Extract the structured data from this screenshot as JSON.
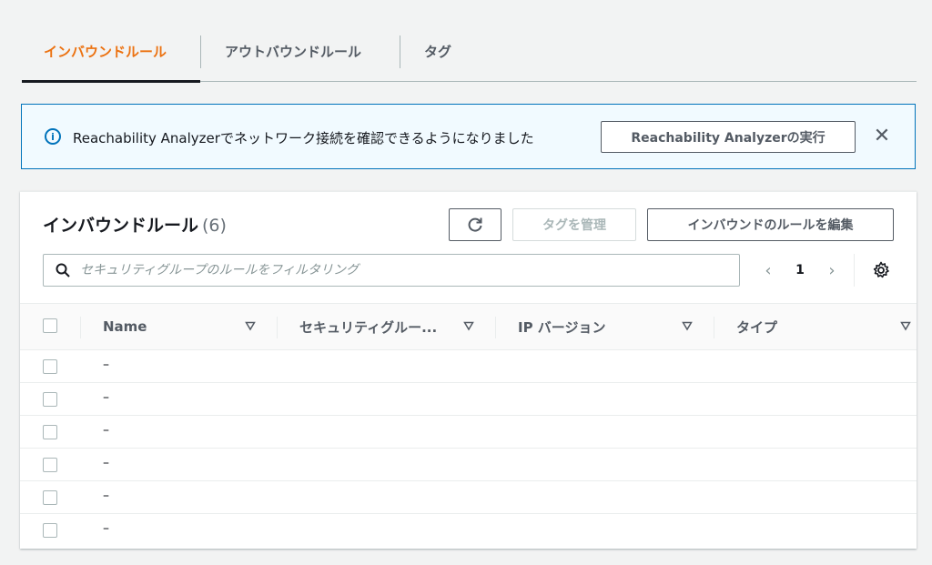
{
  "tabs": [
    {
      "label": "インバウンドルール",
      "active": true
    },
    {
      "label": "アウトバウンドルール",
      "active": false
    },
    {
      "label": "タグ",
      "active": false
    }
  ],
  "flash": {
    "message": "Reachability Analyzerでネットワーク接続を確認できるようになりました",
    "button": "Reachability Analyzerの実行",
    "info_icon": "i",
    "close_icon": "✕"
  },
  "panel": {
    "title": "インバウンドルール",
    "count": "(6)",
    "buttons": {
      "tags": "タグを管理",
      "edit": "インバウンドのルールを編集"
    },
    "search": {
      "placeholder": "セキュリティグループのルールをフィルタリング",
      "value": ""
    },
    "pagination": {
      "current": "1",
      "prev": "‹",
      "next": "›"
    }
  },
  "table": {
    "columns": [
      "Name",
      "セキュリティグルー...",
      "IP バージョン",
      "タイプ"
    ],
    "rows": [
      {
        "name": "–"
      },
      {
        "name": "–"
      },
      {
        "name": "–"
      },
      {
        "name": "–"
      },
      {
        "name": "–"
      },
      {
        "name": "–"
      }
    ]
  },
  "colors": {
    "accent": "#ec7211",
    "info": "#0073bb"
  }
}
